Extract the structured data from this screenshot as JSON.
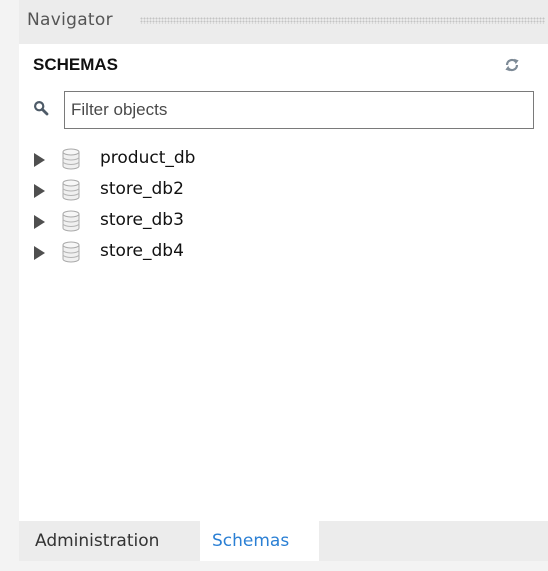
{
  "navigator": {
    "title": "Navigator"
  },
  "schemas": {
    "title": "SCHEMAS",
    "refresh_icon": "refresh-icon",
    "search_icon": "search-icon",
    "filter": {
      "placeholder": "Filter objects",
      "value": ""
    },
    "items": [
      {
        "name": "product_db",
        "icon": "database-icon"
      },
      {
        "name": "store_db2",
        "icon": "database-icon"
      },
      {
        "name": "store_db3",
        "icon": "database-icon"
      },
      {
        "name": "store_db4",
        "icon": "database-icon"
      }
    ]
  },
  "tabs": [
    {
      "label": "Administration",
      "active": false
    },
    {
      "label": "Schemas",
      "active": true
    }
  ],
  "colors": {
    "header_bg": "#ececec",
    "active_tab_text": "#2a7fd4",
    "arrow": "#4f4f4f"
  }
}
